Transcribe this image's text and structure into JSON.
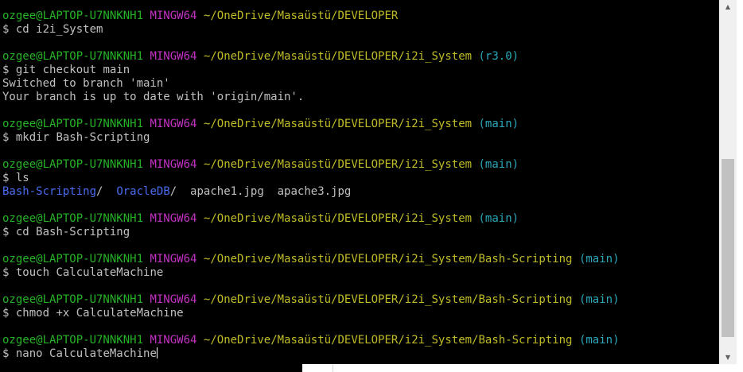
{
  "terminal": {
    "prompt_symbol": "$",
    "sessions": [
      {
        "user": "ozgee@LAPTOP-U7NNKNH1",
        "shell": "MINGW64",
        "path": "~/OneDrive/Masaüstü/DEVELOPER",
        "branch": "",
        "command": "cd i2i_System",
        "output": []
      },
      {
        "user": "ozgee@LAPTOP-U7NNKNH1",
        "shell": "MINGW64",
        "path": "~/OneDrive/Masaüstü/DEVELOPER/i2i_System",
        "branch": "(r3.0)",
        "command": "git checkout main",
        "output": [
          "Switched to branch 'main'",
          "Your branch is up to date with 'origin/main'."
        ]
      },
      {
        "user": "ozgee@LAPTOP-U7NNKNH1",
        "shell": "MINGW64",
        "path": "~/OneDrive/Masaüstü/DEVELOPER/i2i_System",
        "branch": "(main)",
        "command": "mkdir Bash-Scripting",
        "output": []
      },
      {
        "user": "ozgee@LAPTOP-U7NNKNH1",
        "shell": "MINGW64",
        "path": "~/OneDrive/Masaüstü/DEVELOPER/i2i_System",
        "branch": "(main)",
        "command": "ls",
        "output": [],
        "listing": [
          {
            "name": "Bash-Scripting",
            "suffix": "/",
            "type": "dir",
            "gap": "  "
          },
          {
            "name": "OracleDB",
            "suffix": "/",
            "type": "dir",
            "gap": "  "
          },
          {
            "name": "apache1.jpg",
            "suffix": "",
            "type": "file",
            "gap": "  "
          },
          {
            "name": "apache3.jpg",
            "suffix": "",
            "type": "file",
            "gap": ""
          }
        ]
      },
      {
        "user": "ozgee@LAPTOP-U7NNKNH1",
        "shell": "MINGW64",
        "path": "~/OneDrive/Masaüstü/DEVELOPER/i2i_System",
        "branch": "(main)",
        "command": "cd Bash-Scripting",
        "output": []
      },
      {
        "user": "ozgee@LAPTOP-U7NNKNH1",
        "shell": "MINGW64",
        "path": "~/OneDrive/Masaüstü/DEVELOPER/i2i_System/Bash-Scripting",
        "branch": "(main)",
        "command": "touch CalculateMachine",
        "output": []
      },
      {
        "user": "ozgee@LAPTOP-U7NNKNH1",
        "shell": "MINGW64",
        "path": "~/OneDrive/Masaüstü/DEVELOPER/i2i_System/Bash-Scripting",
        "branch": "(main)",
        "command": "chmod +x CalculateMachine",
        "output": []
      },
      {
        "user": "ozgee@LAPTOP-U7NNKNH1",
        "shell": "MINGW64",
        "path": "~/OneDrive/Masaüstü/DEVELOPER/i2i_System/Bash-Scripting",
        "branch": "(main)",
        "command": "nano CalculateMachine",
        "output": [],
        "active": true
      }
    ]
  },
  "scrollbar": {
    "up_arrow": "▲",
    "down_arrow": "▼"
  },
  "colors": {
    "user": "#26b226",
    "shell": "#c331c3",
    "path": "#bfbc26",
    "branch": "#2aa6b8",
    "directory": "#4a6cf0",
    "text": "#c0c0c0",
    "background": "#000000"
  }
}
